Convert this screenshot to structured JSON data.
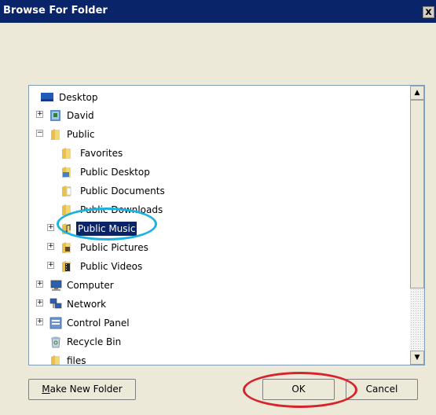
{
  "window": {
    "title": "Browse For Folder",
    "close_glyph": "x"
  },
  "tree": {
    "items": [
      {
        "label": "Desktop",
        "icon": "desktop-icon",
        "expander": ""
      },
      {
        "label": "David",
        "icon": "user-folder-icon",
        "expander": "+"
      },
      {
        "label": "Public",
        "icon": "folder-icon",
        "expander": "−"
      },
      {
        "label": "Favorites",
        "icon": "folder-icon",
        "expander": ""
      },
      {
        "label": "Public Desktop",
        "icon": "desktop-folder-icon",
        "expander": ""
      },
      {
        "label": "Public Documents",
        "icon": "documents-folder-icon",
        "expander": ""
      },
      {
        "label": "Public Downloads",
        "icon": "folder-icon",
        "expander": ""
      },
      {
        "label": "Public Music",
        "icon": "music-folder-icon",
        "expander": "+",
        "selected": true
      },
      {
        "label": "Public Pictures",
        "icon": "pictures-folder-icon",
        "expander": "+"
      },
      {
        "label": "Public Videos",
        "icon": "videos-folder-icon",
        "expander": "+"
      },
      {
        "label": "Computer",
        "icon": "computer-icon",
        "expander": "+"
      },
      {
        "label": "Network",
        "icon": "network-icon",
        "expander": "+"
      },
      {
        "label": "Control Panel",
        "icon": "control-panel-icon",
        "expander": "+"
      },
      {
        "label": "Recycle Bin",
        "icon": "recycle-bin-icon",
        "expander": ""
      },
      {
        "label": "files",
        "icon": "folder-icon",
        "expander": ""
      }
    ]
  },
  "scrollbar": {
    "up_glyph": "▲",
    "down_glyph": "▼"
  },
  "buttons": {
    "make_new_folder_mnemonic": "M",
    "make_new_folder_rest": "ake New Folder",
    "ok": "OK",
    "cancel": "Cancel"
  },
  "colors": {
    "selection": "#0a246a",
    "annotation_blue": "#1ab2e3",
    "annotation_red": "#d9232b"
  }
}
